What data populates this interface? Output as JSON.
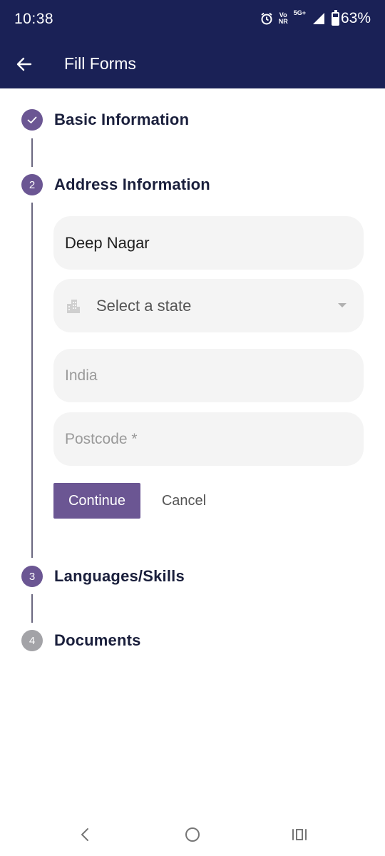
{
  "status_bar": {
    "time": "10:38",
    "net_top": "Vo",
    "net_bottom": "NR",
    "network": "5G+",
    "battery": "63%",
    "battery_level": 0.63
  },
  "app_bar": {
    "title": "Fill Forms",
    "back_icon": "arrow-left-icon"
  },
  "stepper": {
    "steps": [
      {
        "number": "",
        "label": "Basic Information",
        "state": "completed",
        "icon": "check-icon"
      },
      {
        "number": "2",
        "label": "Address Information",
        "state": "active"
      },
      {
        "number": "3",
        "label": "Languages/Skills",
        "state": "pending"
      },
      {
        "number": "4",
        "label": "Documents",
        "state": "disabled"
      }
    ]
  },
  "address_form": {
    "address_value": "Deep Nagar",
    "state_placeholder": "Select a state",
    "state_icon": "building-icon",
    "country_placeholder": "India",
    "postcode_placeholder": "Postcode *",
    "continue_label": "Continue",
    "cancel_label": "Cancel"
  },
  "colors": {
    "header": "#1a2156",
    "accent": "#6b5693",
    "disabled": "#a3a3a7",
    "field_bg": "#f4f4f4"
  },
  "nav_bar": {
    "icons": [
      "back-nav-icon",
      "home-nav-icon",
      "recents-nav-icon"
    ]
  }
}
